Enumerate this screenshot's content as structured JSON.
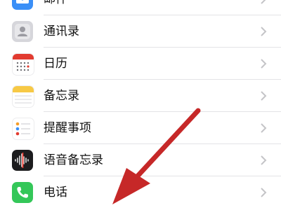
{
  "settings_list": {
    "items": [
      {
        "label": "邮件",
        "icon": "mail-icon"
      },
      {
        "label": "通讯录",
        "icon": "contacts-icon"
      },
      {
        "label": "日历",
        "icon": "calendar-icon"
      },
      {
        "label": "备忘录",
        "icon": "notes-icon"
      },
      {
        "label": "提醒事项",
        "icon": "reminders-icon"
      },
      {
        "label": "语音备忘录",
        "icon": "voice-memos-icon"
      },
      {
        "label": "电话",
        "icon": "phone-icon"
      }
    ]
  },
  "overlay": {
    "arrow_color": "#c62828"
  }
}
